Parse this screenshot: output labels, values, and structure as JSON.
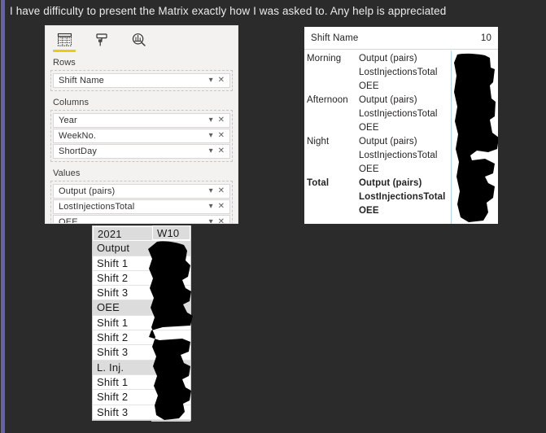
{
  "post": {
    "text": "I have difficulty to present the Matrix exactly how I was asked to. Any help is appreciated"
  },
  "colors": {
    "accent_rail": "#6264A7",
    "background": "#2B2B2B",
    "pane_background": "#F3F2F1",
    "active_tab_underline": "#F2C811",
    "matrix_separator": "#B7D3E8",
    "table_header_fill": "#DCDCDC",
    "redaction": "#000000"
  },
  "visualizations_pane": {
    "tabs": [
      {
        "name": "fields-tab",
        "icon": "fields-grid-icon",
        "active": true
      },
      {
        "name": "format-tab",
        "icon": "paint-roller-icon",
        "active": false
      },
      {
        "name": "analytics-tab",
        "icon": "magnifier-chart-icon",
        "active": false
      }
    ],
    "wells": [
      {
        "label": "Rows",
        "fields": [
          {
            "name": "Shift Name",
            "chevron": "chevron-down-icon",
            "remove": "close-icon"
          }
        ]
      },
      {
        "label": "Columns",
        "fields": [
          {
            "name": "Year",
            "chevron": "chevron-down-icon",
            "remove": "close-icon"
          },
          {
            "name": "WeekNo.",
            "chevron": "chevron-down-icon",
            "remove": "close-icon"
          },
          {
            "name": "ShortDay",
            "chevron": "chevron-down-icon",
            "remove": "close-icon"
          }
        ]
      },
      {
        "label": "Values",
        "fields": [
          {
            "name": "Output (pairs)",
            "chevron": "chevron-down-icon",
            "remove": "close-icon"
          },
          {
            "name": "LostInjectionsTotal",
            "chevron": "chevron-down-icon",
            "remove": "close-icon"
          },
          {
            "name": "OEE",
            "chevron": "chevron-down-icon",
            "remove": "close-icon"
          }
        ]
      }
    ]
  },
  "matrix_visual": {
    "column_header": {
      "row_field_label": "Shift Name",
      "column_value": "10"
    },
    "rows": [
      {
        "group": "Morning",
        "measure": "Output (pairs)",
        "total": false
      },
      {
        "group": "",
        "measure": "LostInjectionsTotal",
        "total": false
      },
      {
        "group": "",
        "measure": "OEE",
        "total": false
      },
      {
        "group": "Afternoon",
        "measure": "Output (pairs)",
        "total": false
      },
      {
        "group": "",
        "measure": "LostInjectionsTotal",
        "total": false
      },
      {
        "group": "",
        "measure": "OEE",
        "total": false
      },
      {
        "group": "Night",
        "measure": "Output (pairs)",
        "total": false
      },
      {
        "group": "",
        "measure": "LostInjectionsTotal",
        "total": false
      },
      {
        "group": "",
        "measure": "OEE",
        "total": false
      },
      {
        "group": "Total",
        "measure": "Output (pairs)",
        "total": true
      },
      {
        "group": "",
        "measure": "LostInjectionsTotal",
        "total": true
      },
      {
        "group": "",
        "measure": "OEE",
        "total": true
      }
    ],
    "data_column_redacted": true
  },
  "desired_table": {
    "header": {
      "year": "2021",
      "week": "W10"
    },
    "rows": [
      {
        "label": "Output",
        "style": "shaded"
      },
      {
        "label": "Shift 1",
        "style": "plain"
      },
      {
        "label": "Shift 2",
        "style": "plain"
      },
      {
        "label": "Shift 3",
        "style": "plain"
      },
      {
        "label": "OEE",
        "style": "shaded"
      },
      {
        "label": "Shift 1",
        "style": "plain"
      },
      {
        "label": "Shift 2",
        "style": "plain"
      },
      {
        "label": "Shift 3",
        "style": "plain"
      },
      {
        "label": "L. Inj.",
        "style": "shaded"
      },
      {
        "label": "Shift 1",
        "style": "plain"
      },
      {
        "label": "Shift 2",
        "style": "plain"
      },
      {
        "label": "Shift 3",
        "style": "plain"
      }
    ],
    "data_column_redacted": true
  }
}
